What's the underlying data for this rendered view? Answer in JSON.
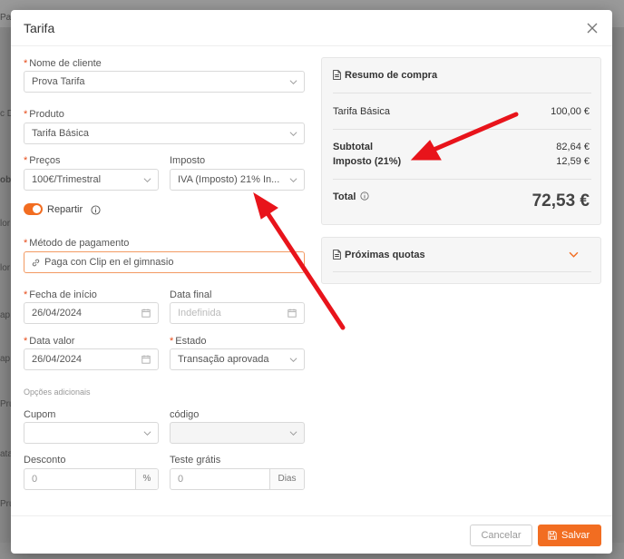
{
  "background": {
    "fragments": [
      "Pa",
      "c D",
      "ob",
      "lor",
      "lor",
      "ap",
      "ap",
      "Pru",
      "ata",
      "Pru"
    ]
  },
  "modal": {
    "title": "Tarifa",
    "close_icon": "close-icon"
  },
  "form": {
    "client": {
      "label": "Nome de cliente",
      "value": "Prova Tarifa",
      "required": true
    },
    "product": {
      "label": "Produto",
      "value": "Tarifa Básica",
      "required": true
    },
    "prices": {
      "label": "Preços",
      "value": "100€/Trimestral",
      "required": true
    },
    "tax": {
      "label": "Imposto",
      "value": "IVA (Imposto) 21% In..."
    },
    "split": {
      "label": "Repartir",
      "on": true
    },
    "payment": {
      "label": "Método de pagamento",
      "value": "Paga con Clip en el gimnasio",
      "required": true
    },
    "start_date": {
      "label": "Fecha de início",
      "value": "26/04/2024",
      "required": true
    },
    "end_date": {
      "label": "Data final",
      "placeholder": "Indefinida"
    },
    "value_date": {
      "label": "Data valor",
      "value": "26/04/2024",
      "required": true
    },
    "status": {
      "label": "Estado",
      "value": "Transação aprovada",
      "required": true
    },
    "extra_options_title": "Opções adicionais",
    "coupon": {
      "label": "Cupom",
      "value": ""
    },
    "code": {
      "label": "código",
      "value": ""
    },
    "discount": {
      "label": "Desconto",
      "value": "0",
      "suffix": "%"
    },
    "trial": {
      "label": "Teste grátis",
      "value": "0",
      "suffix": "Dias"
    },
    "required_mark": "*"
  },
  "summary": {
    "title": "Resumo de compra",
    "item_name": "Tarifa Básica",
    "item_price": "100,00 €",
    "subtotal_label": "Subtotal",
    "subtotal_value": "82,64 €",
    "tax_label": "Imposto (21%)",
    "tax_value": "12,59 €",
    "total_label": "Total",
    "total_value": "72,53 €"
  },
  "quotas": {
    "title": "Próximas quotas"
  },
  "footer": {
    "cancel_label": "Cancelar",
    "save_label": "Salvar"
  },
  "colors": {
    "accent": "#f26d21",
    "annotation_arrow": "#e8141b"
  }
}
